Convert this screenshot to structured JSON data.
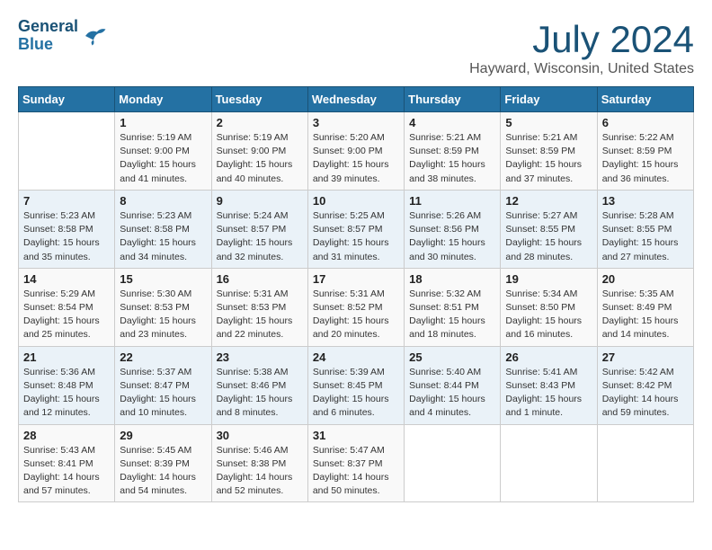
{
  "header": {
    "logo_line1": "General",
    "logo_line2": "Blue",
    "month_year": "July 2024",
    "location": "Hayward, Wisconsin, United States"
  },
  "weekdays": [
    "Sunday",
    "Monday",
    "Tuesday",
    "Wednesday",
    "Thursday",
    "Friday",
    "Saturday"
  ],
  "weeks": [
    [
      {
        "day": "",
        "sunrise": "",
        "sunset": "",
        "daylight": ""
      },
      {
        "day": "1",
        "sunrise": "Sunrise: 5:19 AM",
        "sunset": "Sunset: 9:00 PM",
        "daylight": "Daylight: 15 hours and 41 minutes."
      },
      {
        "day": "2",
        "sunrise": "Sunrise: 5:19 AM",
        "sunset": "Sunset: 9:00 PM",
        "daylight": "Daylight: 15 hours and 40 minutes."
      },
      {
        "day": "3",
        "sunrise": "Sunrise: 5:20 AM",
        "sunset": "Sunset: 9:00 PM",
        "daylight": "Daylight: 15 hours and 39 minutes."
      },
      {
        "day": "4",
        "sunrise": "Sunrise: 5:21 AM",
        "sunset": "Sunset: 8:59 PM",
        "daylight": "Daylight: 15 hours and 38 minutes."
      },
      {
        "day": "5",
        "sunrise": "Sunrise: 5:21 AM",
        "sunset": "Sunset: 8:59 PM",
        "daylight": "Daylight: 15 hours and 37 minutes."
      },
      {
        "day": "6",
        "sunrise": "Sunrise: 5:22 AM",
        "sunset": "Sunset: 8:59 PM",
        "daylight": "Daylight: 15 hours and 36 minutes."
      }
    ],
    [
      {
        "day": "7",
        "sunrise": "Sunrise: 5:23 AM",
        "sunset": "Sunset: 8:58 PM",
        "daylight": "Daylight: 15 hours and 35 minutes."
      },
      {
        "day": "8",
        "sunrise": "Sunrise: 5:23 AM",
        "sunset": "Sunset: 8:58 PM",
        "daylight": "Daylight: 15 hours and 34 minutes."
      },
      {
        "day": "9",
        "sunrise": "Sunrise: 5:24 AM",
        "sunset": "Sunset: 8:57 PM",
        "daylight": "Daylight: 15 hours and 32 minutes."
      },
      {
        "day": "10",
        "sunrise": "Sunrise: 5:25 AM",
        "sunset": "Sunset: 8:57 PM",
        "daylight": "Daylight: 15 hours and 31 minutes."
      },
      {
        "day": "11",
        "sunrise": "Sunrise: 5:26 AM",
        "sunset": "Sunset: 8:56 PM",
        "daylight": "Daylight: 15 hours and 30 minutes."
      },
      {
        "day": "12",
        "sunrise": "Sunrise: 5:27 AM",
        "sunset": "Sunset: 8:55 PM",
        "daylight": "Daylight: 15 hours and 28 minutes."
      },
      {
        "day": "13",
        "sunrise": "Sunrise: 5:28 AM",
        "sunset": "Sunset: 8:55 PM",
        "daylight": "Daylight: 15 hours and 27 minutes."
      }
    ],
    [
      {
        "day": "14",
        "sunrise": "Sunrise: 5:29 AM",
        "sunset": "Sunset: 8:54 PM",
        "daylight": "Daylight: 15 hours and 25 minutes."
      },
      {
        "day": "15",
        "sunrise": "Sunrise: 5:30 AM",
        "sunset": "Sunset: 8:53 PM",
        "daylight": "Daylight: 15 hours and 23 minutes."
      },
      {
        "day": "16",
        "sunrise": "Sunrise: 5:31 AM",
        "sunset": "Sunset: 8:53 PM",
        "daylight": "Daylight: 15 hours and 22 minutes."
      },
      {
        "day": "17",
        "sunrise": "Sunrise: 5:31 AM",
        "sunset": "Sunset: 8:52 PM",
        "daylight": "Daylight: 15 hours and 20 minutes."
      },
      {
        "day": "18",
        "sunrise": "Sunrise: 5:32 AM",
        "sunset": "Sunset: 8:51 PM",
        "daylight": "Daylight: 15 hours and 18 minutes."
      },
      {
        "day": "19",
        "sunrise": "Sunrise: 5:34 AM",
        "sunset": "Sunset: 8:50 PM",
        "daylight": "Daylight: 15 hours and 16 minutes."
      },
      {
        "day": "20",
        "sunrise": "Sunrise: 5:35 AM",
        "sunset": "Sunset: 8:49 PM",
        "daylight": "Daylight: 15 hours and 14 minutes."
      }
    ],
    [
      {
        "day": "21",
        "sunrise": "Sunrise: 5:36 AM",
        "sunset": "Sunset: 8:48 PM",
        "daylight": "Daylight: 15 hours and 12 minutes."
      },
      {
        "day": "22",
        "sunrise": "Sunrise: 5:37 AM",
        "sunset": "Sunset: 8:47 PM",
        "daylight": "Daylight: 15 hours and 10 minutes."
      },
      {
        "day": "23",
        "sunrise": "Sunrise: 5:38 AM",
        "sunset": "Sunset: 8:46 PM",
        "daylight": "Daylight: 15 hours and 8 minutes."
      },
      {
        "day": "24",
        "sunrise": "Sunrise: 5:39 AM",
        "sunset": "Sunset: 8:45 PM",
        "daylight": "Daylight: 15 hours and 6 minutes."
      },
      {
        "day": "25",
        "sunrise": "Sunrise: 5:40 AM",
        "sunset": "Sunset: 8:44 PM",
        "daylight": "Daylight: 15 hours and 4 minutes."
      },
      {
        "day": "26",
        "sunrise": "Sunrise: 5:41 AM",
        "sunset": "Sunset: 8:43 PM",
        "daylight": "Daylight: 15 hours and 1 minute."
      },
      {
        "day": "27",
        "sunrise": "Sunrise: 5:42 AM",
        "sunset": "Sunset: 8:42 PM",
        "daylight": "Daylight: 14 hours and 59 minutes."
      }
    ],
    [
      {
        "day": "28",
        "sunrise": "Sunrise: 5:43 AM",
        "sunset": "Sunset: 8:41 PM",
        "daylight": "Daylight: 14 hours and 57 minutes."
      },
      {
        "day": "29",
        "sunrise": "Sunrise: 5:45 AM",
        "sunset": "Sunset: 8:39 PM",
        "daylight": "Daylight: 14 hours and 54 minutes."
      },
      {
        "day": "30",
        "sunrise": "Sunrise: 5:46 AM",
        "sunset": "Sunset: 8:38 PM",
        "daylight": "Daylight: 14 hours and 52 minutes."
      },
      {
        "day": "31",
        "sunrise": "Sunrise: 5:47 AM",
        "sunset": "Sunset: 8:37 PM",
        "daylight": "Daylight: 14 hours and 50 minutes."
      },
      {
        "day": "",
        "sunrise": "",
        "sunset": "",
        "daylight": ""
      },
      {
        "day": "",
        "sunrise": "",
        "sunset": "",
        "daylight": ""
      },
      {
        "day": "",
        "sunrise": "",
        "sunset": "",
        "daylight": ""
      }
    ]
  ]
}
